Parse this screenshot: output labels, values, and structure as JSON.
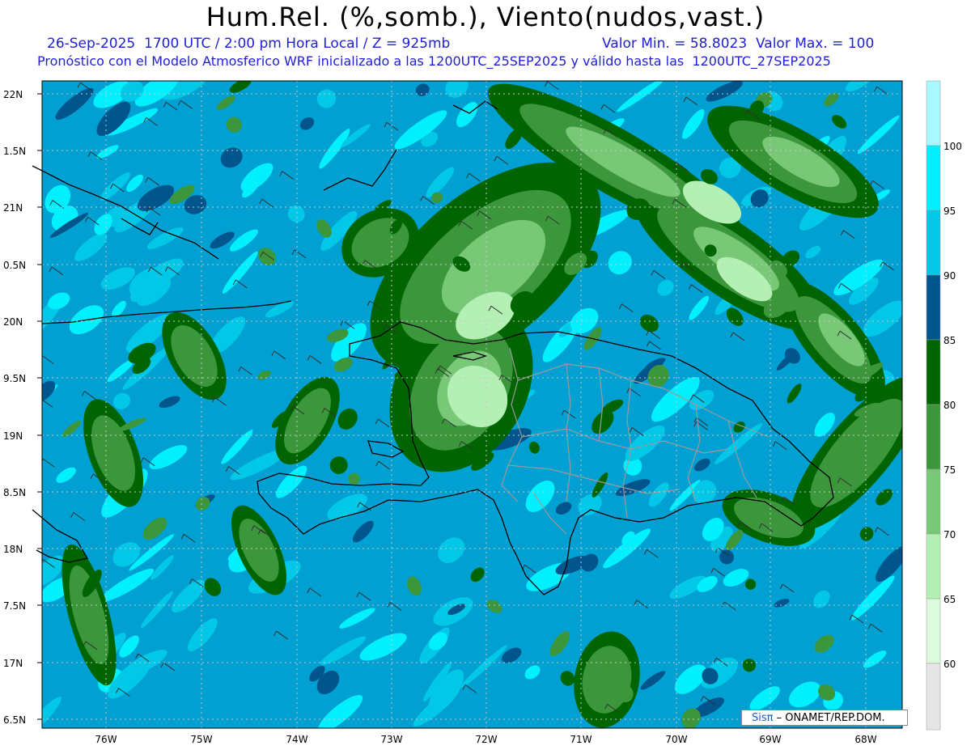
{
  "header": {
    "title": "Hum.Rel. (%,somb.), Viento(nudos,vast.)",
    "line1_left": "26-Sep-2025  1700 UTC / 2:00 pm Hora Local / Z = 925mb",
    "line1_right": "Valor Min. = 58.8023  Valor Max. = 100",
    "line2": "Pronóstico con el Modelo Atmosferico WRF inicializado a las 1200UTC_25SEP2025 y válido hasta las  1200UTC_27SEP2025"
  },
  "axes": {
    "lat_labels": [
      "22N",
      "1.5N",
      "21N",
      "0.5N",
      "20N",
      "9.5N",
      "19N",
      "8.5N",
      "18N",
      "7.5N",
      "17N",
      "6.5N"
    ],
    "lon_labels": [
      "76W",
      "75W",
      "74W",
      "73W",
      "72W",
      "71W",
      "70W",
      "69W",
      "68W"
    ]
  },
  "colorbar": {
    "labels": [
      "100",
      "95",
      "90",
      "85",
      "80",
      "75",
      "70",
      "65",
      "60"
    ],
    "colors": [
      "#a8f8ff",
      "#00f0ff",
      "#00c8e6",
      "#00a0d2",
      "#00558c",
      "#006400",
      "#3c963c",
      "#78c878",
      "#b4f0b4",
      "#dcfadc",
      "#e6e6e6"
    ]
  },
  "palette": {
    "very_humid": "#00f0ff",
    "humid": "#00c8e6",
    "medium": "#00a0d2",
    "dark_blue": "#00558c",
    "dark_green": "#006400",
    "green": "#3c963c",
    "light_green": "#78c878",
    "pale_green": "#b4f0b4",
    "coast": "#000000",
    "provinces": "#9a9a9a"
  },
  "credit": {
    "brand": "Sisπ",
    "text": "– ONAMET/REP.DOM."
  }
}
